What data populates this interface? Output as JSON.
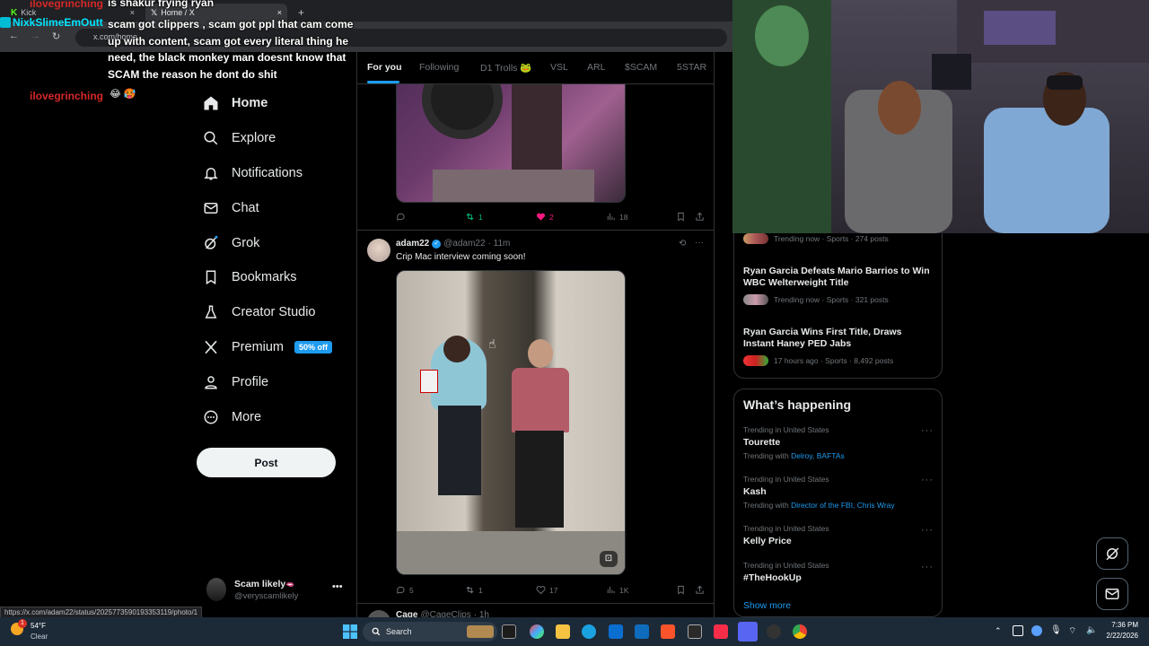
{
  "browser": {
    "tabs": [
      {
        "label": "Kick"
      },
      {
        "label": "Home / X"
      }
    ],
    "url": "x.com/home",
    "status_url": "https://x.com/adam22/status/2025773590193353119/photo/1"
  },
  "chat": {
    "messages": [
      {
        "user": "ilovegrinching",
        "text": "is shakur frying ryan"
      },
      {
        "user": "NixkSlimeEmOutt",
        "text": "scam got clippers , scam got ppl that cam come up with content, scam got every literal thing he need, the black monkey man doesnt know that SCAM the reason he dont do shit"
      },
      {
        "user": "ilovegrinching",
        "text": "😂 🥵"
      }
    ]
  },
  "nav": {
    "items": [
      {
        "label": "Home",
        "icon": "home-icon"
      },
      {
        "label": "Explore",
        "icon": "search-icon"
      },
      {
        "label": "Notifications",
        "icon": "bell-icon"
      },
      {
        "label": "Chat",
        "icon": "mail-icon"
      },
      {
        "label": "Grok",
        "icon": "grok-icon"
      },
      {
        "label": "Bookmarks",
        "icon": "bookmark-icon"
      },
      {
        "label": "Creator Studio",
        "icon": "flask-icon"
      },
      {
        "label": "Premium",
        "icon": "x-logo-icon"
      },
      {
        "label": "Profile",
        "icon": "person-icon"
      },
      {
        "label": "More",
        "icon": "more-circle-icon"
      }
    ],
    "premium_badge": "50% off",
    "post_label": "Post",
    "account": {
      "name": "Scam likely",
      "emoji": "🫦",
      "handle": "@veryscamlikely"
    }
  },
  "feed": {
    "tabs": [
      "For you",
      "Following",
      "D1 Trolls 🐸",
      "VSL",
      "ARL",
      "$SCAM",
      "5STAR"
    ],
    "top_post": {
      "replies": "",
      "reposts": "1",
      "likes": "2",
      "views": "18"
    },
    "post": {
      "name": "adam22",
      "handle": "@adam22",
      "time": "· 11m",
      "text": "Crip Mac interview coming soon!",
      "replies": "5",
      "reposts": "1",
      "likes": "17",
      "views": "1K"
    },
    "next_post": {
      "name": "Cage",
      "handle": "@CageClips",
      "time": "· 1h"
    }
  },
  "trends_top": [
    {
      "title": "",
      "meta": "Trending now · Sports · 274 posts"
    },
    {
      "title": "Ryan Garcia Defeats Mario Barrios to Win WBC Welterweight Title",
      "meta": "Trending now · Sports · 321 posts"
    },
    {
      "title": "Ryan Garcia Wins First Title, Draws Instant Haney PED Jabs",
      "meta": "17 hours ago · Sports · 8,492 posts"
    }
  ],
  "whats_happening": {
    "title": "What’s happening",
    "trends": [
      {
        "context": "Trending in United States",
        "name": "Tourette",
        "with_label": "Trending with",
        "with": "Delroy, BAFTAs"
      },
      {
        "context": "Trending in United States",
        "name": "Kash",
        "with_label": "Trending with",
        "with": "Director of the FBI, Chris Wray"
      },
      {
        "context": "Trending in United States",
        "name": "Kelly Price"
      },
      {
        "context": "Trending in United States",
        "name": "#TheHookUp"
      }
    ],
    "show_more": "Show more"
  },
  "taskbar": {
    "weather_temp": "54°F",
    "weather_desc": "Clear",
    "search_placeholder": "Search",
    "time": "7:36 PM",
    "date": "2/22/2026",
    "notification_count": "1"
  },
  "colors": {
    "accent": "#1d9bf0",
    "like": "#f91880",
    "repost": "#00ba7c",
    "chat_red": "#d62828",
    "chat_cyan": "#00e5ff"
  }
}
